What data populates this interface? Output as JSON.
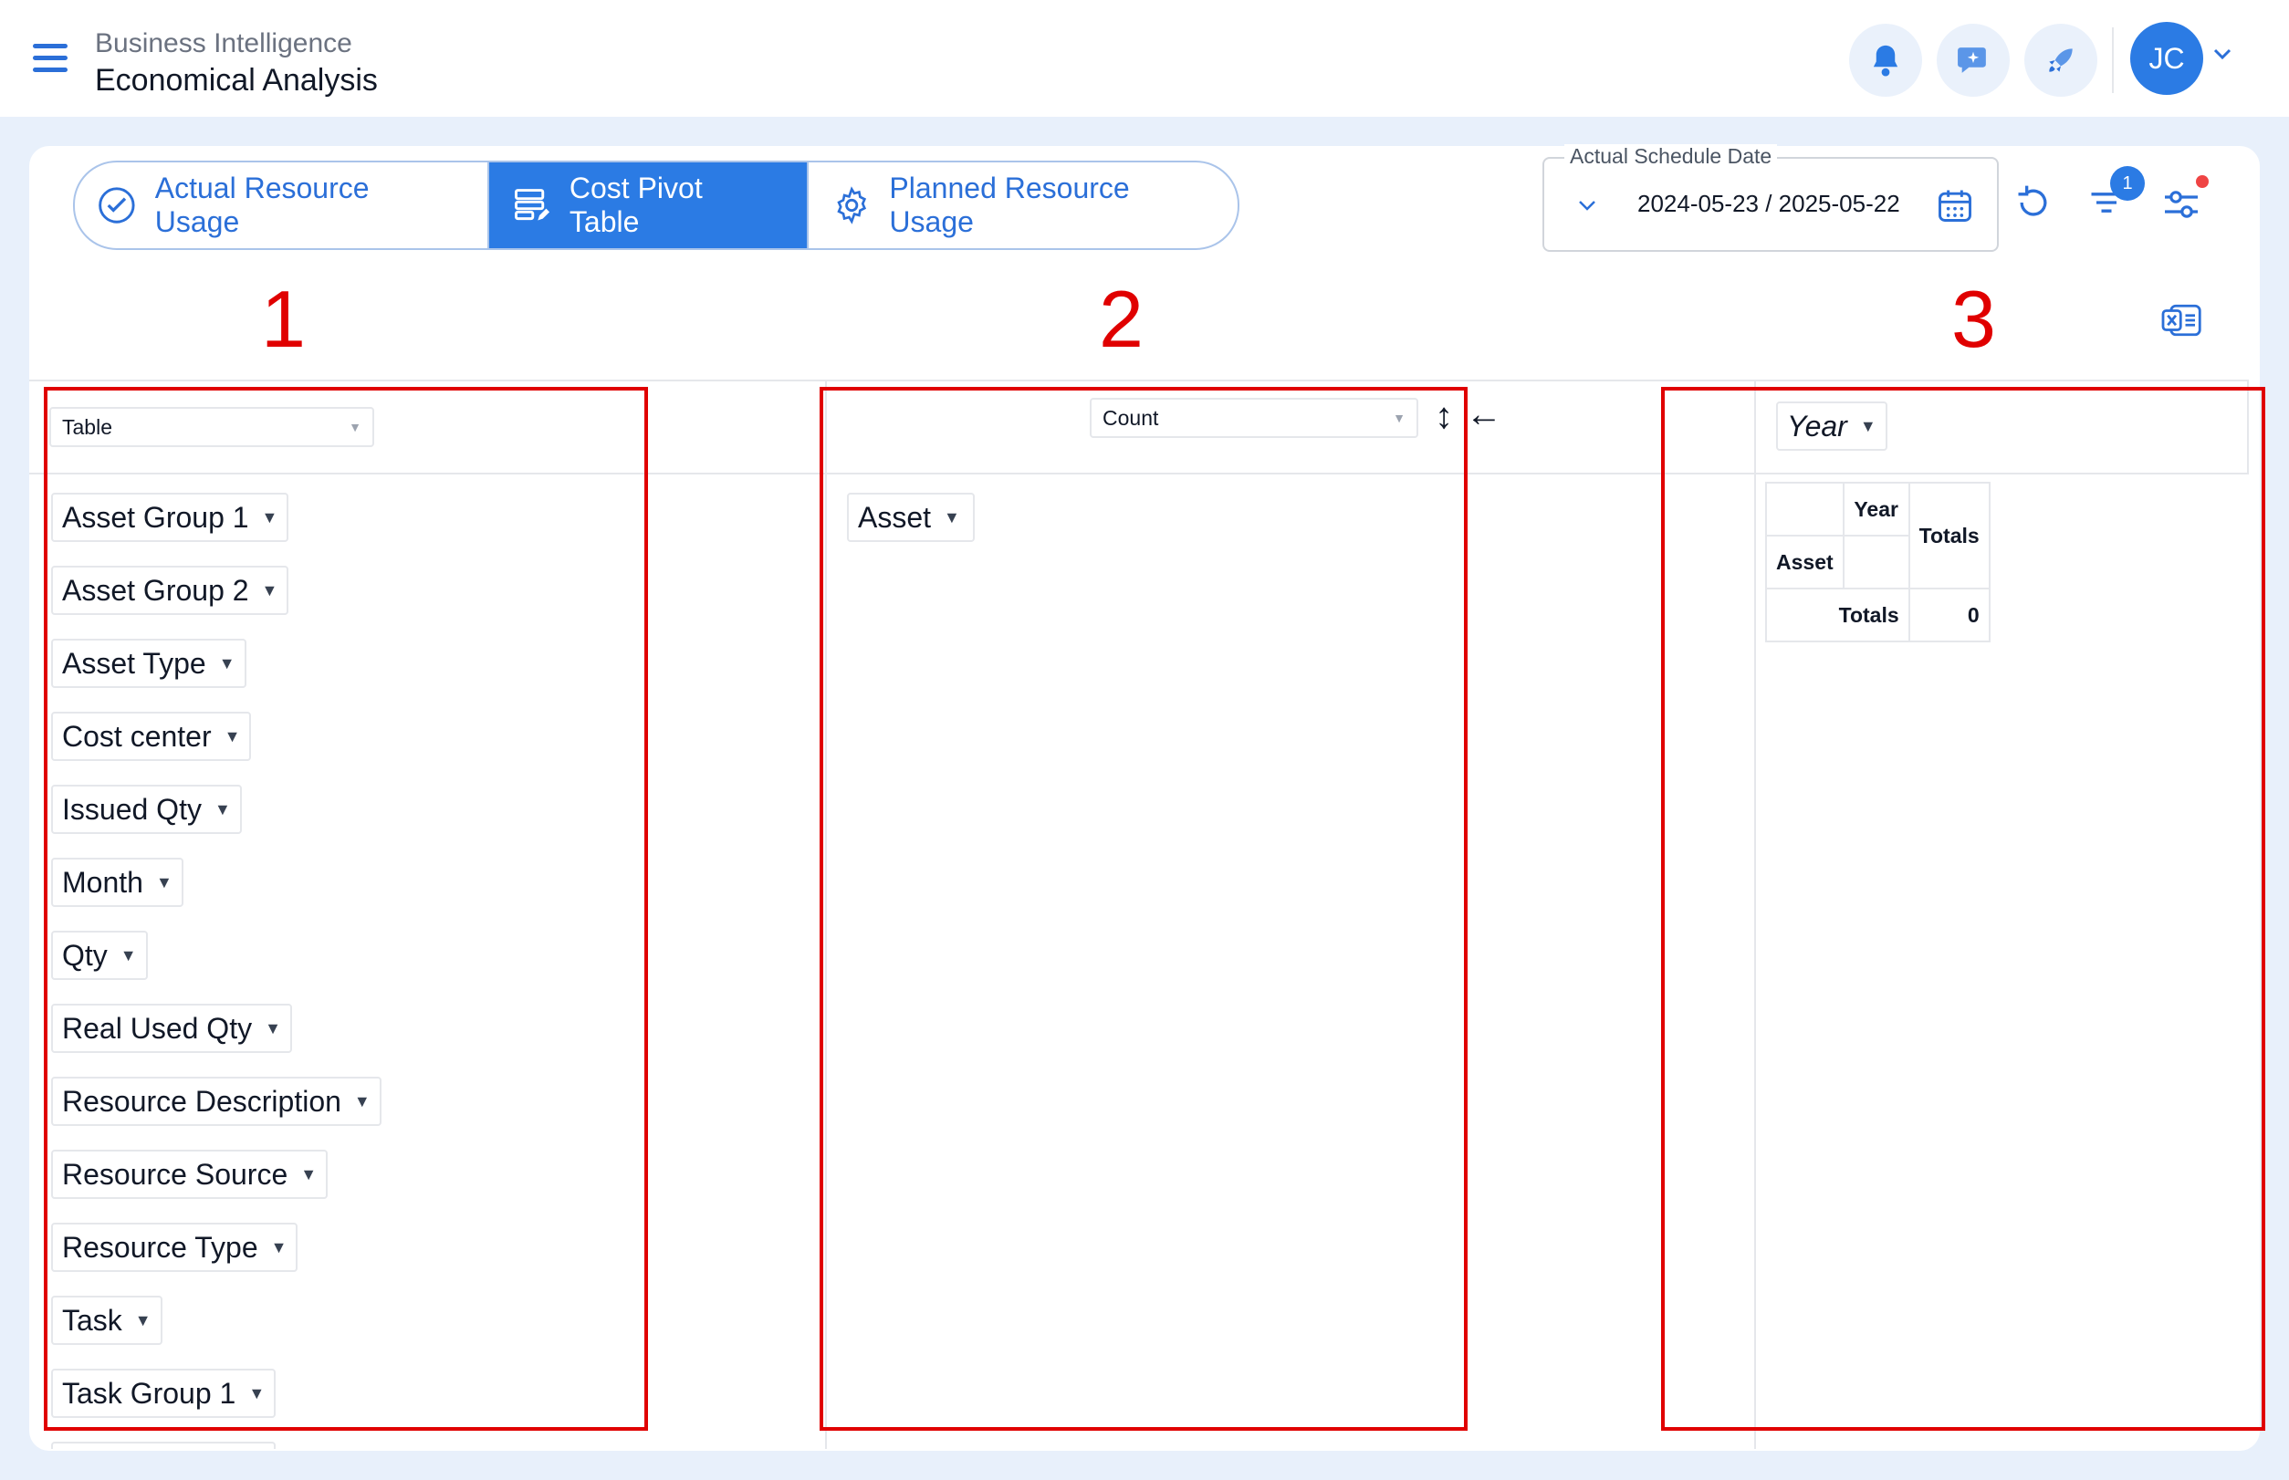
{
  "header": {
    "subtitle": "Business Intelligence",
    "title": "Economical Analysis",
    "avatar_initials": "JC",
    "icons": [
      "menu-icon",
      "bell-icon",
      "chat-sparkle-icon",
      "rocket-icon",
      "chevron-down-icon"
    ]
  },
  "tabs": [
    {
      "label": "Actual Resource Usage",
      "icon": "check-circle-icon",
      "active": false
    },
    {
      "label": "Cost Pivot Table",
      "icon": "table-edit-icon",
      "active": true
    },
    {
      "label": "Planned Resource Usage",
      "icon": "gear-icon",
      "active": false
    }
  ],
  "date_filter": {
    "label": "Actual Schedule Date",
    "value": "2024-05-23 / 2025-05-22"
  },
  "filter_badge": "1",
  "annotations": [
    "1",
    "2",
    "3"
  ],
  "pivot": {
    "renderer": "Table",
    "aggregator": "Count",
    "sort_glyph": "↕",
    "arrow_glyph": "←",
    "unused_fields": [
      "Asset Group 1",
      "Asset Group 2",
      "Asset Type",
      "Cost center",
      "Issued Qty",
      "Month",
      "Qty",
      "Real Used Qty",
      "Resource Description",
      "Resource Source",
      "Resource Type",
      "Task",
      "Task Group 1"
    ],
    "row_fields": [
      "Asset"
    ],
    "col_fields": [
      "Year"
    ],
    "table": {
      "col_header": "Year",
      "row_header": "Asset",
      "totals_label": "Totals",
      "grand_total": "0"
    }
  },
  "colors": {
    "accent": "#2b7be4",
    "annotation": "#e00000",
    "background": "#e8f0fb"
  }
}
